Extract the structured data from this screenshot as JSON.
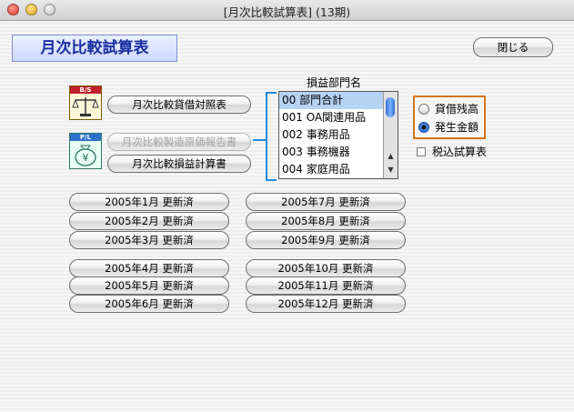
{
  "window": {
    "title": "[月次比較試算表]  (13期)"
  },
  "app_title": "月次比較試算表",
  "buttons": {
    "close": "閉じる",
    "balance_sheet": "月次比較貸借対照表",
    "manufacturing_cost": "月次比較製造原価報告書",
    "income_statement": "月次比較損益計算書"
  },
  "icons": {
    "bs_band": "B/S",
    "pl_band": "P/L",
    "bs_icon": "scales-icon",
    "pl_icon": "money-bag-icon"
  },
  "department": {
    "label": "損益部門名",
    "items": [
      {
        "label": "00  部門合計",
        "selected": true
      },
      {
        "label": "001  OA関連用品",
        "selected": false
      },
      {
        "label": "002  事務用品",
        "selected": false
      },
      {
        "label": "003  事務機器",
        "selected": false
      },
      {
        "label": "004  家庭用品",
        "selected": false
      }
    ]
  },
  "mode": {
    "options": [
      {
        "label": "貸借残高",
        "selected": false
      },
      {
        "label": "発生金額",
        "selected": true
      }
    ]
  },
  "tax_inclusive": {
    "label": "税込試算表",
    "checked": false
  },
  "months_left": [
    "2005年1月 更新済",
    "2005年2月 更新済",
    "2005年3月 更新済",
    "2005年4月 更新済",
    "2005年5月 更新済",
    "2005年6月 更新済"
  ],
  "months_right": [
    "2005年7月 更新済",
    "2005年8月 更新済",
    "2005年9月 更新済",
    "2005年10月 更新済",
    "2005年11月 更新済",
    "2005年12月 更新済"
  ],
  "colors": {
    "accent_blue": "#1e8be0",
    "radio_border": "#d4751a",
    "title_text": "#1a2fa0"
  }
}
